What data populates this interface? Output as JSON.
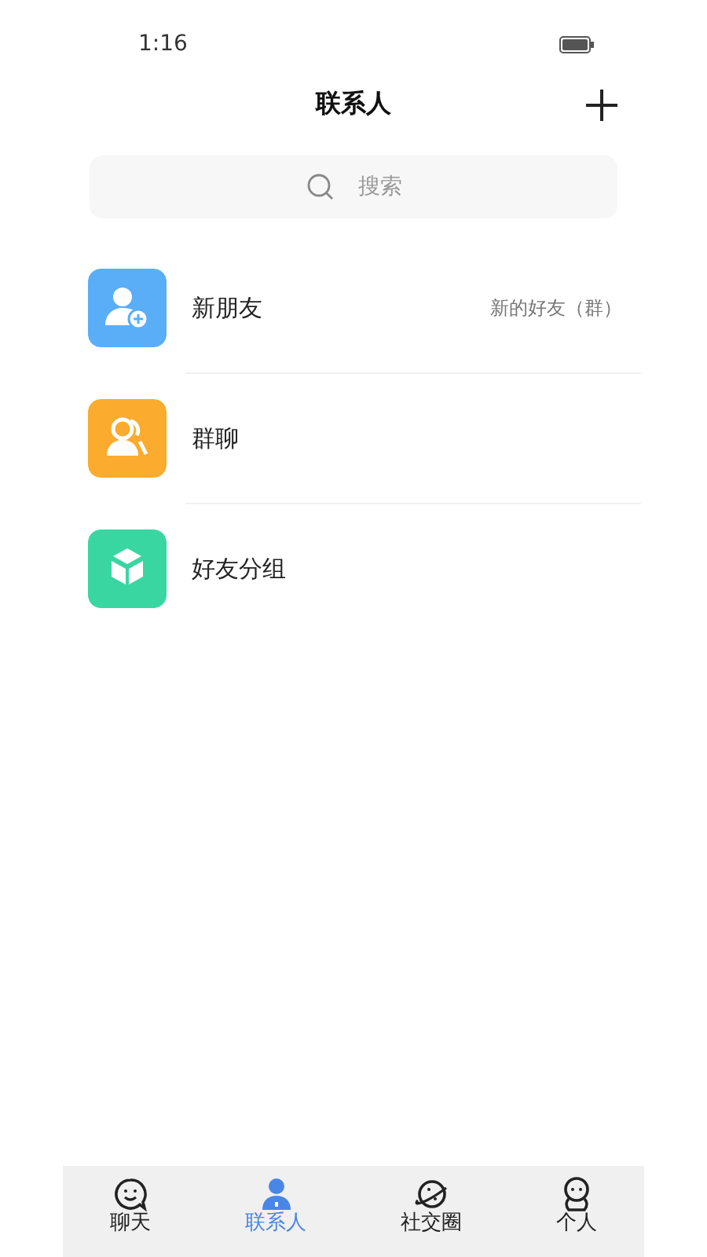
{
  "status_bar": {
    "time": "1:16"
  },
  "header": {
    "title": "联系人"
  },
  "search": {
    "placeholder": "搜索"
  },
  "items": [
    {
      "kind": "add-friend",
      "color": "#5aaef8",
      "label": "新朋友",
      "note": "新的好友（群）"
    },
    {
      "kind": "group-chat",
      "color": "#fbab2d",
      "label": "群聊"
    },
    {
      "kind": "friend-group",
      "color": "#3ad6a1",
      "label": "好友分组"
    }
  ],
  "tabs": [
    {
      "kind": "chat",
      "label": "聊天",
      "selected": false
    },
    {
      "kind": "contacts",
      "label": "联系人",
      "selected": true
    },
    {
      "kind": "social",
      "label": "社交圈",
      "selected": false
    },
    {
      "kind": "me",
      "label": "个人",
      "selected": false
    }
  ]
}
